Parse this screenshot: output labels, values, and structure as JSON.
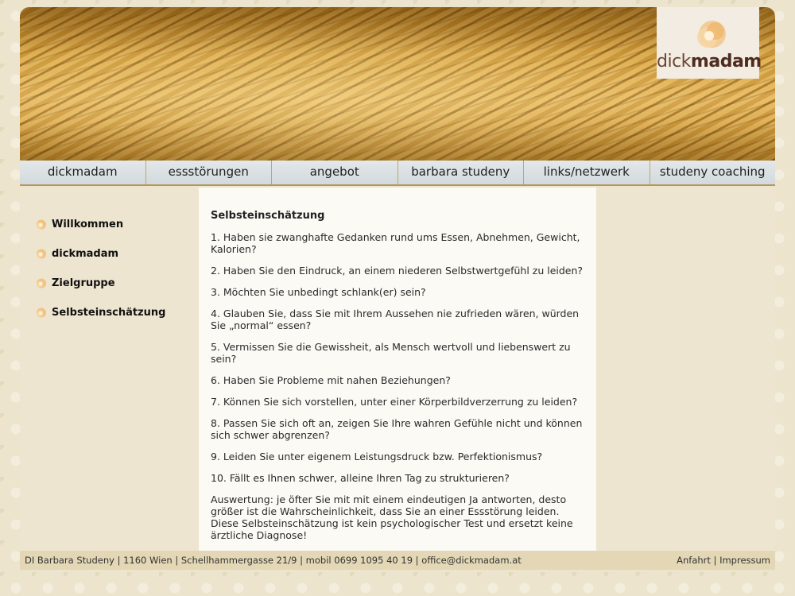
{
  "logo": {
    "text_light": "dick",
    "text_bold": "madam"
  },
  "nav": [
    {
      "label": "dickmadam"
    },
    {
      "label": "essstörungen"
    },
    {
      "label": "angebot"
    },
    {
      "label": "barbara studeny"
    },
    {
      "label": "links/netzwerk"
    },
    {
      "label": "studeny coaching"
    }
  ],
  "sidebar": [
    {
      "label": "Willkommen",
      "icon": "flower-bullet-icon"
    },
    {
      "label": "dickmadam",
      "icon": "flower-bullet-icon"
    },
    {
      "label": "Zielgruppe",
      "icon": "flower-bullet-icon"
    },
    {
      "label": "Selbsteinschätzung",
      "icon": "flower-bullet-icon"
    }
  ],
  "content": {
    "title": "Selbsteinschätzung",
    "paragraphs": [
      "1. Haben sie zwanghafte Gedanken rund ums Essen, Abnehmen, Gewicht, Kalorien?",
      "2. Haben Sie den Eindruck, an einem niederen Selbstwertgefühl zu leiden?",
      "3. Möchten Sie unbedingt schlank(er) sein?",
      "4. Glauben Sie, dass Sie mit Ihrem Aussehen nie zufrieden wären, würden Sie „normal“ essen?",
      "5. Vermissen Sie die Gewissheit, als Mensch wertvoll und liebenswert zu sein?",
      "6. Haben Sie Probleme mit nahen Beziehungen?",
      "7. Können Sie sich vorstellen, unter einer Körperbildverzerrung zu leiden?",
      "8. Passen Sie sich oft an, zeigen Sie Ihre wahren Gefühle nicht und können sich schwer abgrenzen?",
      "9. Leiden Sie unter eigenem Leistungsdruck bzw. Perfektionismus?",
      "10. Fällt es Ihnen schwer, alleine Ihren Tag zu strukturieren?",
      "Auswertung: je öfter Sie mit mit einem eindeutigen Ja antworten, desto größer ist die Wahrscheinlichkeit, dass Sie an einer Essstörung leiden. Diese Selbsteinschätzung ist kein psychologischer Test und ersetzt keine ärztliche Diagnose!"
    ]
  },
  "footer": {
    "address": "DI Barbara Studeny | 1160 Wien | Schellhammergasse 21/9 | mobil 0699 1095 40 19 | office@dickmadam.at",
    "link_anfahrt": "Anfahrt",
    "separator": "|",
    "link_impressum": "Impressum"
  },
  "colors": {
    "nav_background": "#d8dfe2",
    "sidebar_background": "#ede5cf",
    "content_background": "#fbfaf5",
    "footer_background": "#e3d7b6",
    "logo_text": "#5e3a2a"
  }
}
